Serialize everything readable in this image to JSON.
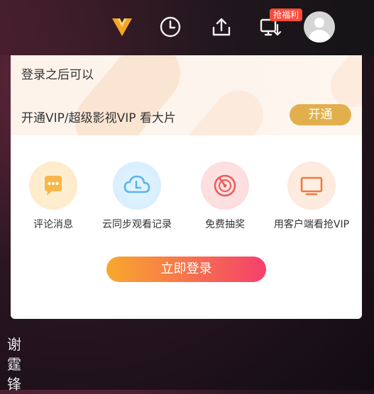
{
  "topbar": {
    "badge": "抢福利",
    "icons": [
      "vip-logo-icon",
      "clock-icon",
      "upload-icon",
      "device-sync-icon",
      "avatar-icon"
    ]
  },
  "popup": {
    "login_hint": "登录之后可以",
    "vip_text": "开通VIP/超级影视VIP 看大片",
    "open_button": "开通",
    "features": [
      {
        "label": "评论消息",
        "icon": "comment-icon"
      },
      {
        "label": "云同步观看记录",
        "icon": "cloud-sync-icon"
      },
      {
        "label": "免费抽奖",
        "icon": "lottery-icon"
      },
      {
        "label": "用客户端看抢VIP",
        "icon": "tv-icon"
      }
    ],
    "login_button": "立即登录"
  },
  "background": {
    "side_text": [
      "谢",
      "霆",
      "锋"
    ]
  },
  "colors": {
    "accent_gold": "#e1b04d",
    "gradient_start": "#f8a82e",
    "gradient_end": "#f5406b",
    "badge_red": "#ff4a3a"
  }
}
